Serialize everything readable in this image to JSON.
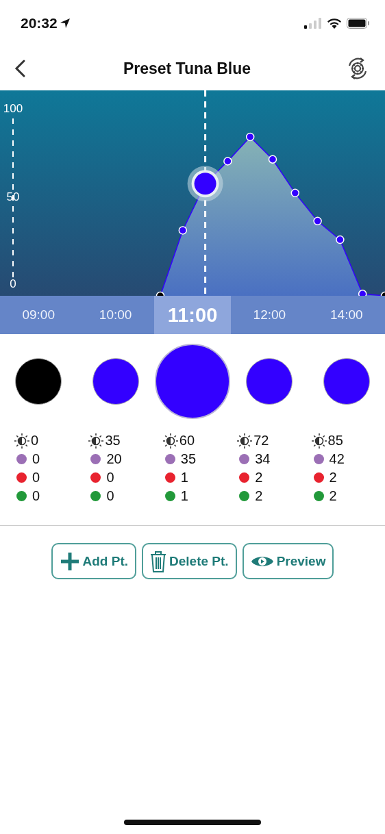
{
  "status_bar": {
    "time": "20:32"
  },
  "nav": {
    "title": "Preset Tuna Blue"
  },
  "chart": {
    "y_labels": [
      "100",
      "50",
      "0"
    ]
  },
  "time_strip": [
    {
      "label": "09:00",
      "selected": false
    },
    {
      "label": "10:00",
      "selected": false
    },
    {
      "label": "11:00",
      "selected": true
    },
    {
      "label": "12:00",
      "selected": false
    },
    {
      "label": "14:00",
      "selected": false
    }
  ],
  "points": [
    {
      "color": "#000000",
      "selected": false,
      "brightness": "0",
      "channels": [
        {
          "color": "#9b6fb5",
          "value": "0"
        },
        {
          "color": "#e8232f",
          "value": "0"
        },
        {
          "color": "#22993a",
          "value": "0"
        }
      ]
    },
    {
      "color": "#3300ff",
      "selected": false,
      "brightness": "35",
      "channels": [
        {
          "color": "#9b6fb5",
          "value": "20"
        },
        {
          "color": "#e8232f",
          "value": "0"
        },
        {
          "color": "#22993a",
          "value": "0"
        }
      ]
    },
    {
      "color": "#3300ff",
      "selected": true,
      "brightness": "60",
      "channels": [
        {
          "color": "#9b6fb5",
          "value": "35"
        },
        {
          "color": "#e8232f",
          "value": "1"
        },
        {
          "color": "#22993a",
          "value": "1"
        }
      ]
    },
    {
      "color": "#3300ff",
      "selected": false,
      "brightness": "72",
      "channels": [
        {
          "color": "#9b6fb5",
          "value": "34"
        },
        {
          "color": "#e8232f",
          "value": "2"
        },
        {
          "color": "#22993a",
          "value": "2"
        }
      ]
    },
    {
      "color": "#3300ff",
      "selected": false,
      "brightness": "85",
      "channels": [
        {
          "color": "#9b6fb5",
          "value": "42"
        },
        {
          "color": "#e8232f",
          "value": "2"
        },
        {
          "color": "#22993a",
          "value": "2"
        }
      ]
    }
  ],
  "buttons": [
    {
      "kind": "add",
      "label": "Add Pt."
    },
    {
      "kind": "delete",
      "label": "Delete Pt."
    },
    {
      "kind": "preview",
      "label": "Preview"
    }
  ]
}
